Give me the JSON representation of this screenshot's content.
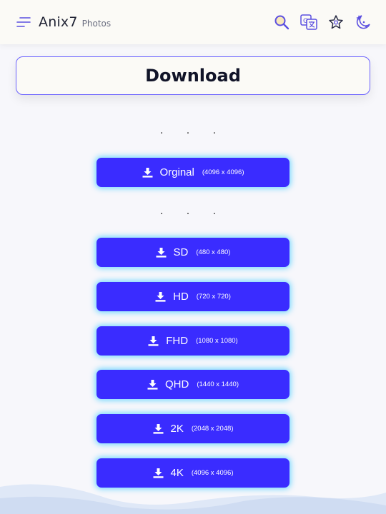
{
  "app": {
    "name": "Anix7",
    "section": "Photos"
  },
  "header_icons": [
    "search-icon",
    "translate-icon",
    "star-badge-icon",
    "moon-stars-icon"
  ],
  "page": {
    "title": "Download"
  },
  "separator": ". . .",
  "original": {
    "label": "Orginal",
    "resolution": "(4096 x 4096)"
  },
  "sizes": [
    {
      "label": "SD",
      "resolution": "(480 x 480)"
    },
    {
      "label": "HD",
      "resolution": "(720 x 720)"
    },
    {
      "label": "FHD",
      "resolution": "(1080 x 1080)"
    },
    {
      "label": "QHD",
      "resolution": "(1440 x 1440)"
    },
    {
      "label": "2K",
      "resolution": "(2048 x 2048)"
    },
    {
      "label": "4K",
      "resolution": "(4096 x 4096)"
    }
  ],
  "colors": {
    "accent": "#3a2cff",
    "glow": "#5fd2ff",
    "outline": "#6c63ff",
    "icon": "#5b4fe0"
  }
}
